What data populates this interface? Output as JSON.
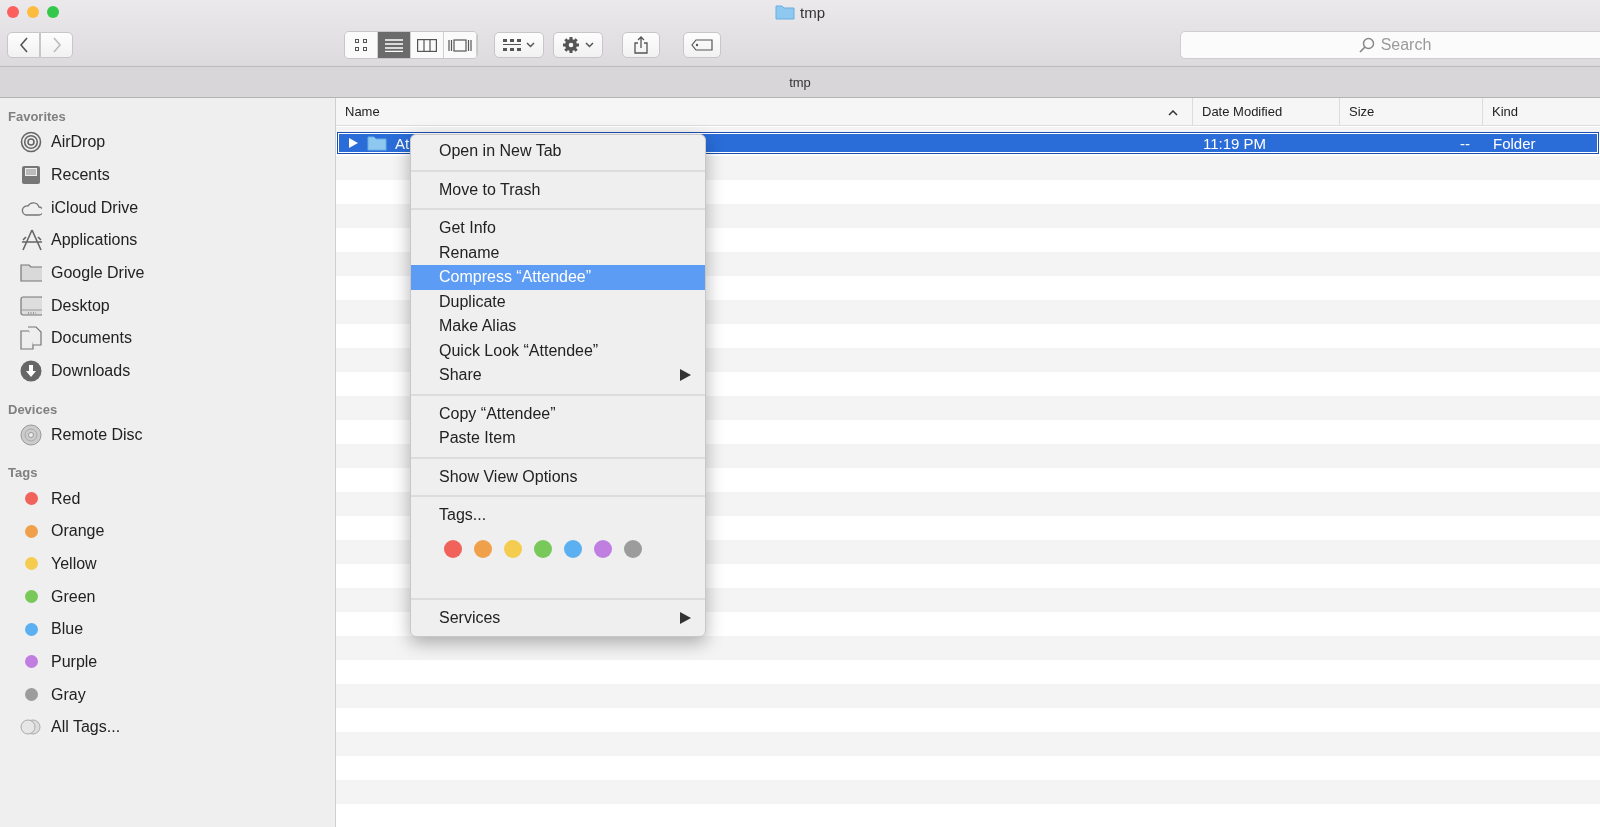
{
  "window": {
    "title": "tmp"
  },
  "toolbar": {
    "view_modes": [
      {
        "selected": false
      },
      {
        "selected": true
      },
      {
        "selected": false
      },
      {
        "selected": false
      }
    ],
    "search": {
      "placeholder": "Search"
    }
  },
  "path_bar": {
    "title": "tmp"
  },
  "sidebar": {
    "sections": [
      {
        "heading": "Favorites",
        "items": [
          {
            "label": "AirDrop",
            "selected": false
          },
          {
            "label": "Recents",
            "selected": false
          },
          {
            "label": "iCloud Drive",
            "selected": false
          },
          {
            "label": "Applications",
            "selected": false
          },
          {
            "label": "Google Drive",
            "selected": false
          },
          {
            "label": "Desktop",
            "selected": false
          },
          {
            "label": "Documents",
            "selected": false
          },
          {
            "label": "Downloads",
            "selected": false
          }
        ]
      },
      {
        "heading": "Devices",
        "items": [
          {
            "label": "Remote Disc",
            "selected": false
          }
        ]
      },
      {
        "heading": "Tags",
        "items": [
          {
            "label": "Red",
            "selected": false,
            "color": "#f0625a"
          },
          {
            "label": "Orange",
            "selected": false,
            "color": "#f0a04a"
          },
          {
            "label": "Yellow",
            "selected": false,
            "color": "#f4cc50"
          },
          {
            "label": "Green",
            "selected": false,
            "color": "#78c85a"
          },
          {
            "label": "Blue",
            "selected": false,
            "color": "#5ab0f0"
          },
          {
            "label": "Purple",
            "selected": false,
            "color": "#c07ee0"
          },
          {
            "label": "Gray",
            "selected": false,
            "color": "#9c9c9c"
          },
          {
            "label": "All Tags...",
            "selected": false
          }
        ]
      }
    ]
  },
  "table": {
    "columns": [
      {
        "label": "Name",
        "sorted": true
      },
      {
        "label": "Date Modified",
        "sorted": false
      },
      {
        "label": "Size",
        "sorted": false
      },
      {
        "label": "Kind",
        "sorted": false
      }
    ],
    "rows": [
      {
        "name": "At",
        "date_modified": "11:19 PM",
        "size": "--",
        "kind": "Folder",
        "selected": true,
        "expanded": false
      }
    ]
  },
  "context_menu": {
    "sections": [
      {
        "kind": "items",
        "items": [
          {
            "label": "Open in New Tab",
            "selected": false,
            "submenu": false
          }
        ]
      },
      {
        "kind": "items",
        "items": [
          {
            "label": "Move to Trash",
            "selected": false,
            "submenu": false
          }
        ]
      },
      {
        "kind": "items",
        "items": [
          {
            "label": "Get Info",
            "selected": false,
            "submenu": false
          },
          {
            "label": "Rename",
            "selected": false,
            "submenu": false
          },
          {
            "label": "Compress “Attendee”",
            "selected": true,
            "submenu": false
          },
          {
            "label": "Duplicate",
            "selected": false,
            "submenu": false
          },
          {
            "label": "Make Alias",
            "selected": false,
            "submenu": false
          },
          {
            "label": "Quick Look “Attendee”",
            "selected": false,
            "submenu": false
          },
          {
            "label": "Share",
            "selected": false,
            "submenu": true
          }
        ]
      },
      {
        "kind": "items",
        "items": [
          {
            "label": "Copy “Attendee”",
            "selected": false,
            "submenu": false
          },
          {
            "label": "Paste Item",
            "selected": false,
            "submenu": false
          }
        ]
      },
      {
        "kind": "items",
        "items": [
          {
            "label": "Show View Options",
            "selected": false,
            "submenu": false
          }
        ]
      },
      {
        "kind": "tags",
        "label": "Tags...",
        "colors": [
          {
            "color": "#f0625a"
          },
          {
            "color": "#f0a04a"
          },
          {
            "color": "#f4cc50"
          },
          {
            "color": "#78c85a"
          },
          {
            "color": "#5ab0f0"
          },
          {
            "color": "#c07ee0"
          },
          {
            "color": "#9c9c9c"
          }
        ]
      },
      {
        "kind": "items",
        "items": [
          {
            "label": "Services",
            "selected": false,
            "submenu": true
          }
        ]
      }
    ]
  }
}
